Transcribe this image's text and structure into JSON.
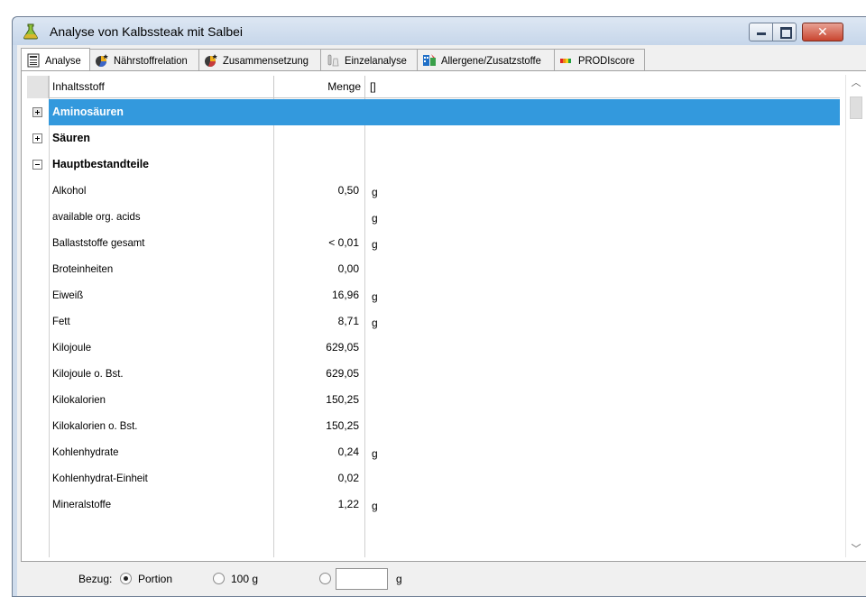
{
  "window": {
    "title": "Analyse von Kalbssteak mit Salbei"
  },
  "tabs": [
    {
      "label": "Analyse",
      "icon": "table-icon",
      "active": true
    },
    {
      "label": "Nährstoffrelation",
      "icon": "pie-chart-icon",
      "active": false
    },
    {
      "label": "Zusammensetzung",
      "icon": "pie-chart-icon",
      "active": false
    },
    {
      "label": "Einzelanalyse",
      "icon": "flask-icon",
      "active": false
    },
    {
      "label": "Allergene/Zusatzstoffe",
      "icon": "allergen-icon",
      "active": false
    },
    {
      "label": "PRODIscore",
      "icon": "score-bar-icon",
      "active": false
    }
  ],
  "table": {
    "headers": {
      "name": "Inhaltsstoff",
      "amount": "Menge",
      "unit": "[]"
    },
    "rows": [
      {
        "name": "Aminosäuren",
        "amount": "",
        "unit": "",
        "group": true,
        "expander": "plus",
        "selected": true
      },
      {
        "name": "Säuren",
        "amount": "",
        "unit": "",
        "group": true,
        "expander": "plus",
        "selected": false
      },
      {
        "name": "Hauptbestandteile",
        "amount": "",
        "unit": "",
        "group": true,
        "expander": "minus",
        "selected": false
      },
      {
        "name": "Alkohol",
        "amount": "0,50",
        "unit": "g"
      },
      {
        "name": "available org. acids",
        "amount": "",
        "unit": "g"
      },
      {
        "name": "Ballaststoffe gesamt",
        "amount": "< 0,01",
        "unit": "g"
      },
      {
        "name": "Broteinheiten",
        "amount": "0,00",
        "unit": ""
      },
      {
        "name": "Eiweiß",
        "amount": "16,96",
        "unit": "g"
      },
      {
        "name": "Fett",
        "amount": "8,71",
        "unit": "g"
      },
      {
        "name": "Kilojoule",
        "amount": "629,05",
        "unit": ""
      },
      {
        "name": "Kilojoule o. Bst.",
        "amount": "629,05",
        "unit": ""
      },
      {
        "name": "Kilokalorien",
        "amount": "150,25",
        "unit": ""
      },
      {
        "name": "Kilokalorien o. Bst.",
        "amount": "150,25",
        "unit": ""
      },
      {
        "name": "Kohlenhydrate",
        "amount": "0,24",
        "unit": "g"
      },
      {
        "name": "Kohlenhydrat-Einheit",
        "amount": "0,02",
        "unit": ""
      },
      {
        "name": "Mineralstoffe",
        "amount": "1,22",
        "unit": "g"
      }
    ]
  },
  "footer": {
    "label": "Bezug:",
    "options": [
      "Portion",
      "100 g",
      ""
    ],
    "selected": "Portion",
    "custom_value": "",
    "custom_unit": "g"
  },
  "colors": {
    "selection": "#3399dd",
    "titlebar": "#cfdcec",
    "close_button": "#c9452f"
  }
}
